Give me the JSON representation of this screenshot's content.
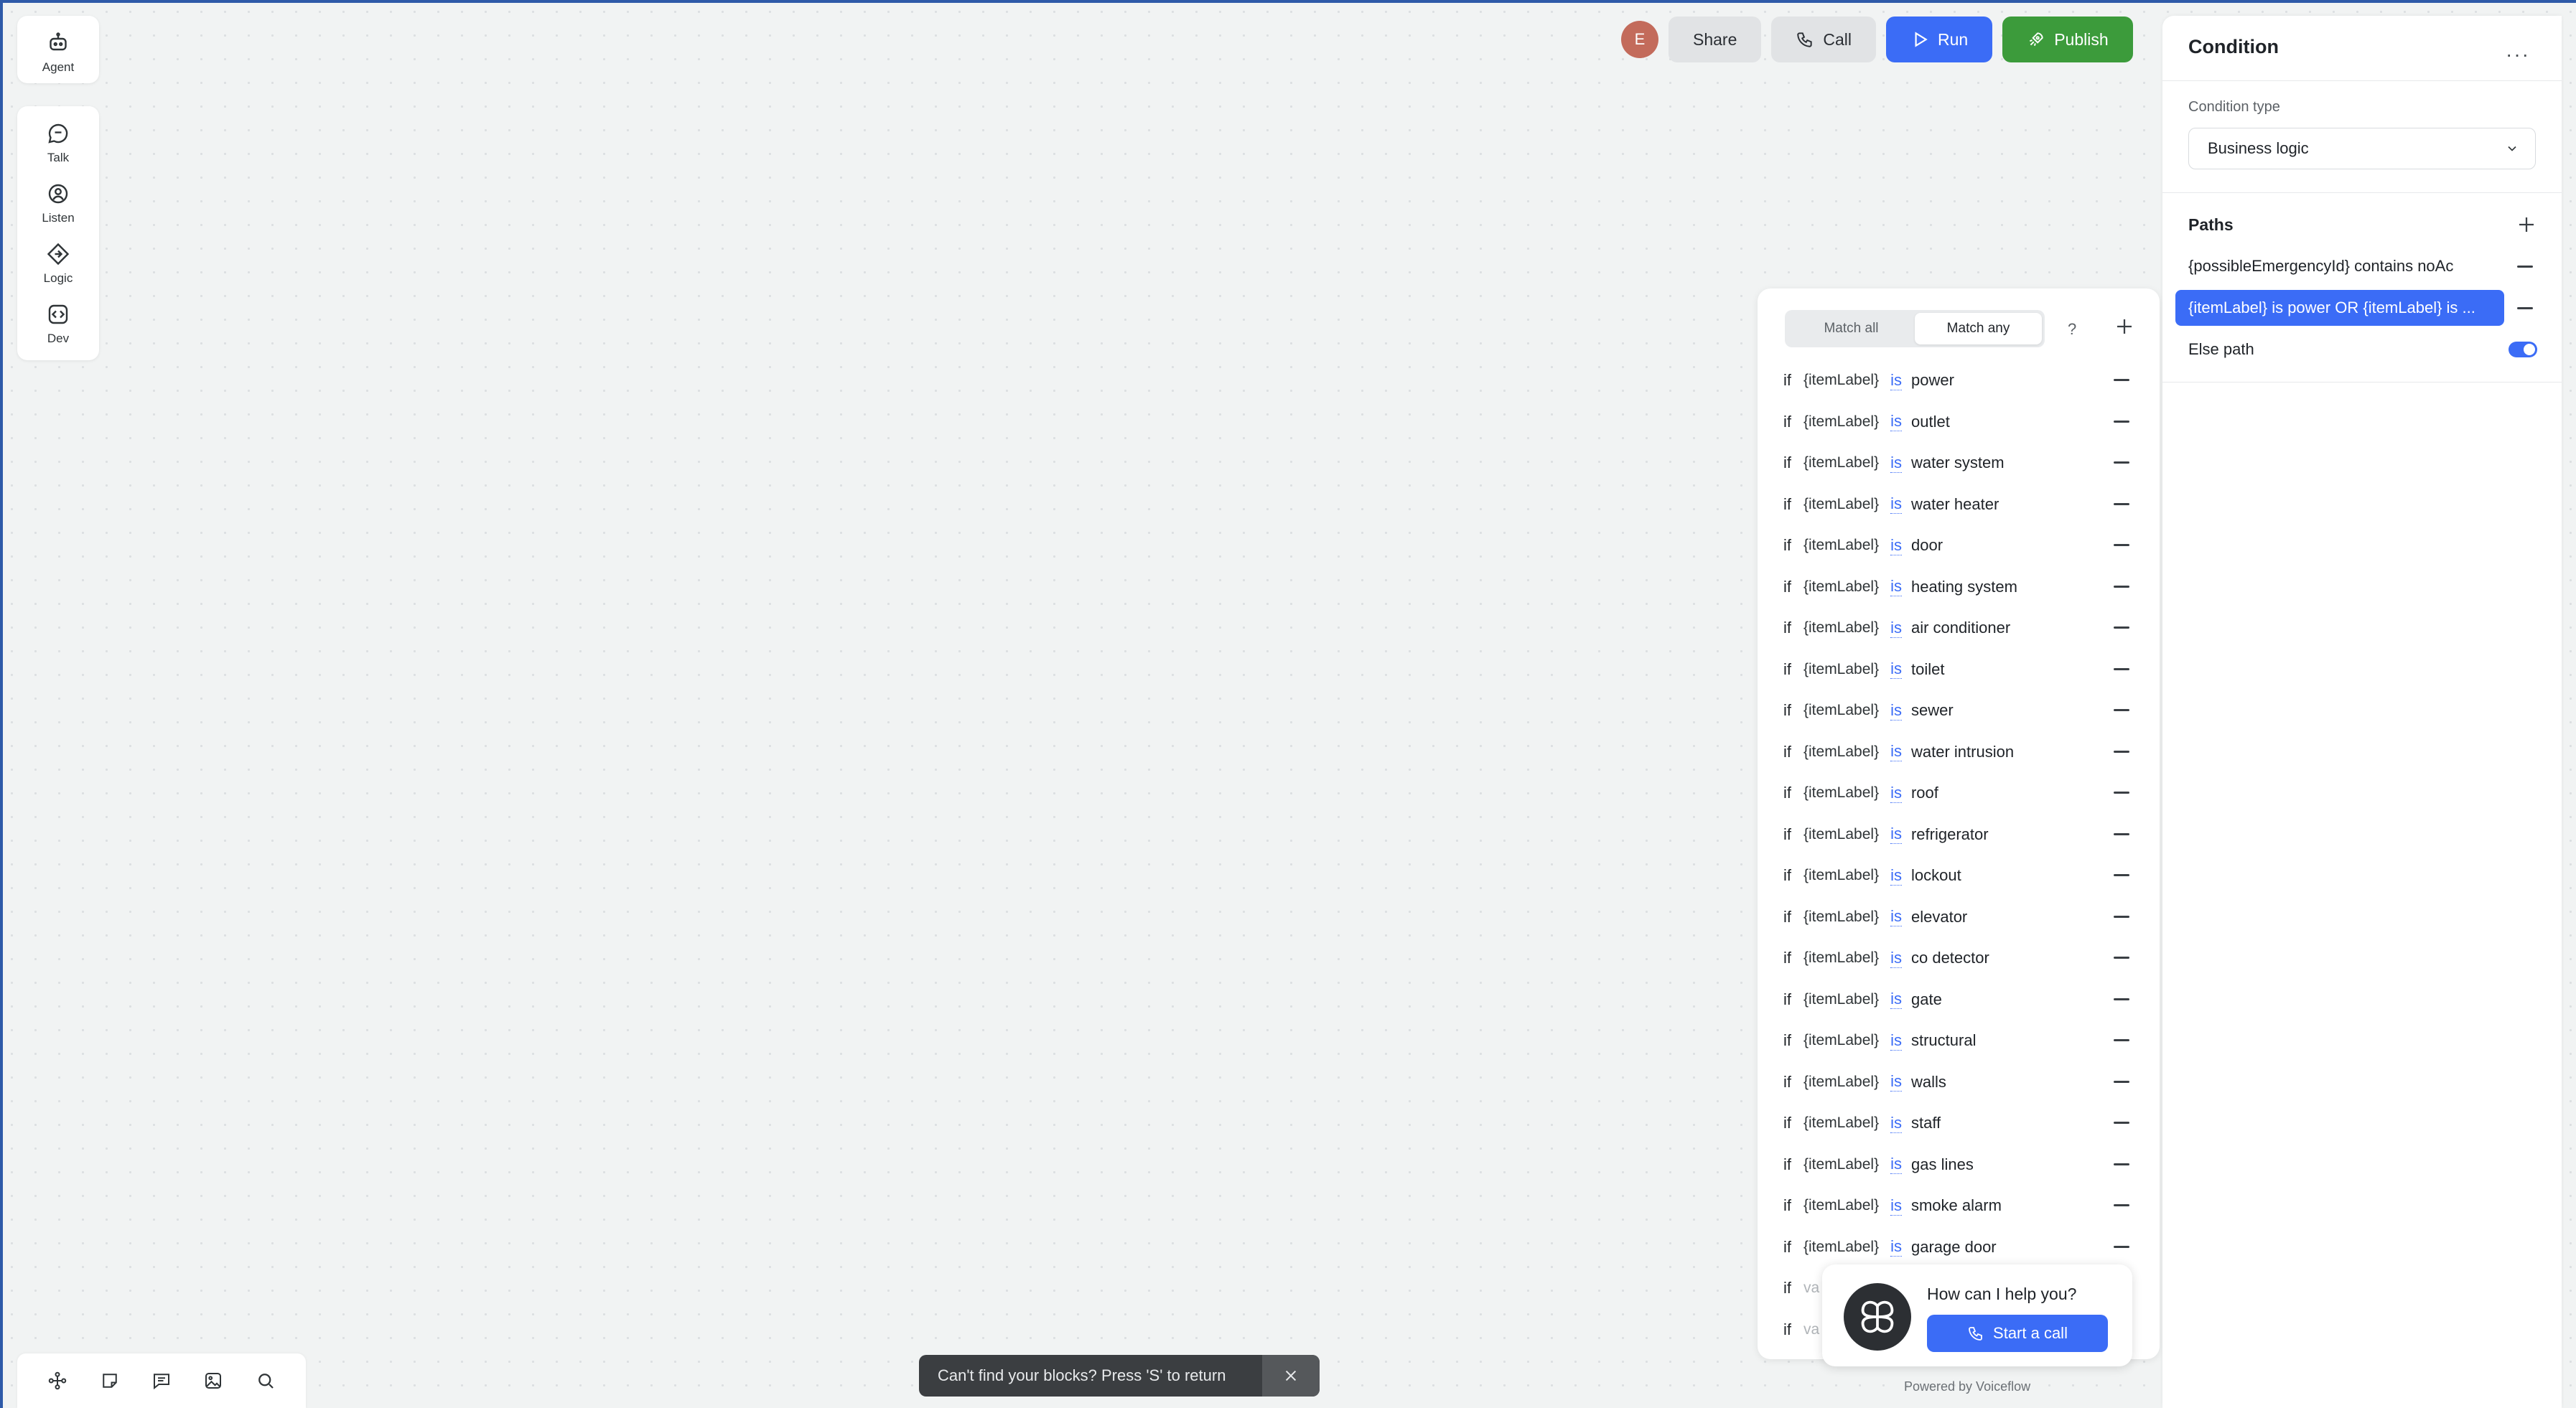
{
  "rail": {
    "agent_label": "Agent",
    "talk_label": "Talk",
    "listen_label": "Listen",
    "logic_label": "Logic",
    "dev_label": "Dev"
  },
  "topbar": {
    "avatar_initial": "E",
    "share_label": "Share",
    "call_label": "Call",
    "run_label": "Run",
    "publish_label": "Publish"
  },
  "condition_panel": {
    "match_all_label": "Match all",
    "match_any_label": "Match any",
    "active_mode": "Match any",
    "help_label": "?",
    "if_word": "if",
    "variable": "{itemLabel}",
    "operator": "is",
    "rules": [
      "power",
      "outlet",
      "water system",
      "water heater",
      "door",
      "heating system",
      "air conditioner",
      "toilet",
      "sewer",
      "water intrusion",
      "roof",
      "refrigerator",
      "lockout",
      "elevator",
      "co detector",
      "gate",
      "structural",
      "walls",
      "staff",
      "gas lines",
      "smoke alarm",
      "garage door"
    ],
    "faded_rules": [
      "va",
      "va"
    ]
  },
  "help_bubble": {
    "question": "How can I help you?",
    "call_button": "Start a call",
    "powered_by": "Powered by Voiceflow"
  },
  "sidebar": {
    "title": "Condition",
    "condition_type_label": "Condition type",
    "condition_type_value": "Business logic",
    "paths_label": "Paths",
    "paths": [
      "{possibleEmergencyId} contains noAc",
      "{itemLabel} is power OR {itemLabel} is ..."
    ],
    "selected_path_index": 1,
    "else_label": "Else path",
    "else_enabled": true
  },
  "toast": {
    "message": "Can't find your blocks? Press 'S' to return"
  },
  "colors": {
    "accent": "#3b6cf6",
    "publish": "#3c9b3b",
    "canvas": "#f1f3f3"
  }
}
